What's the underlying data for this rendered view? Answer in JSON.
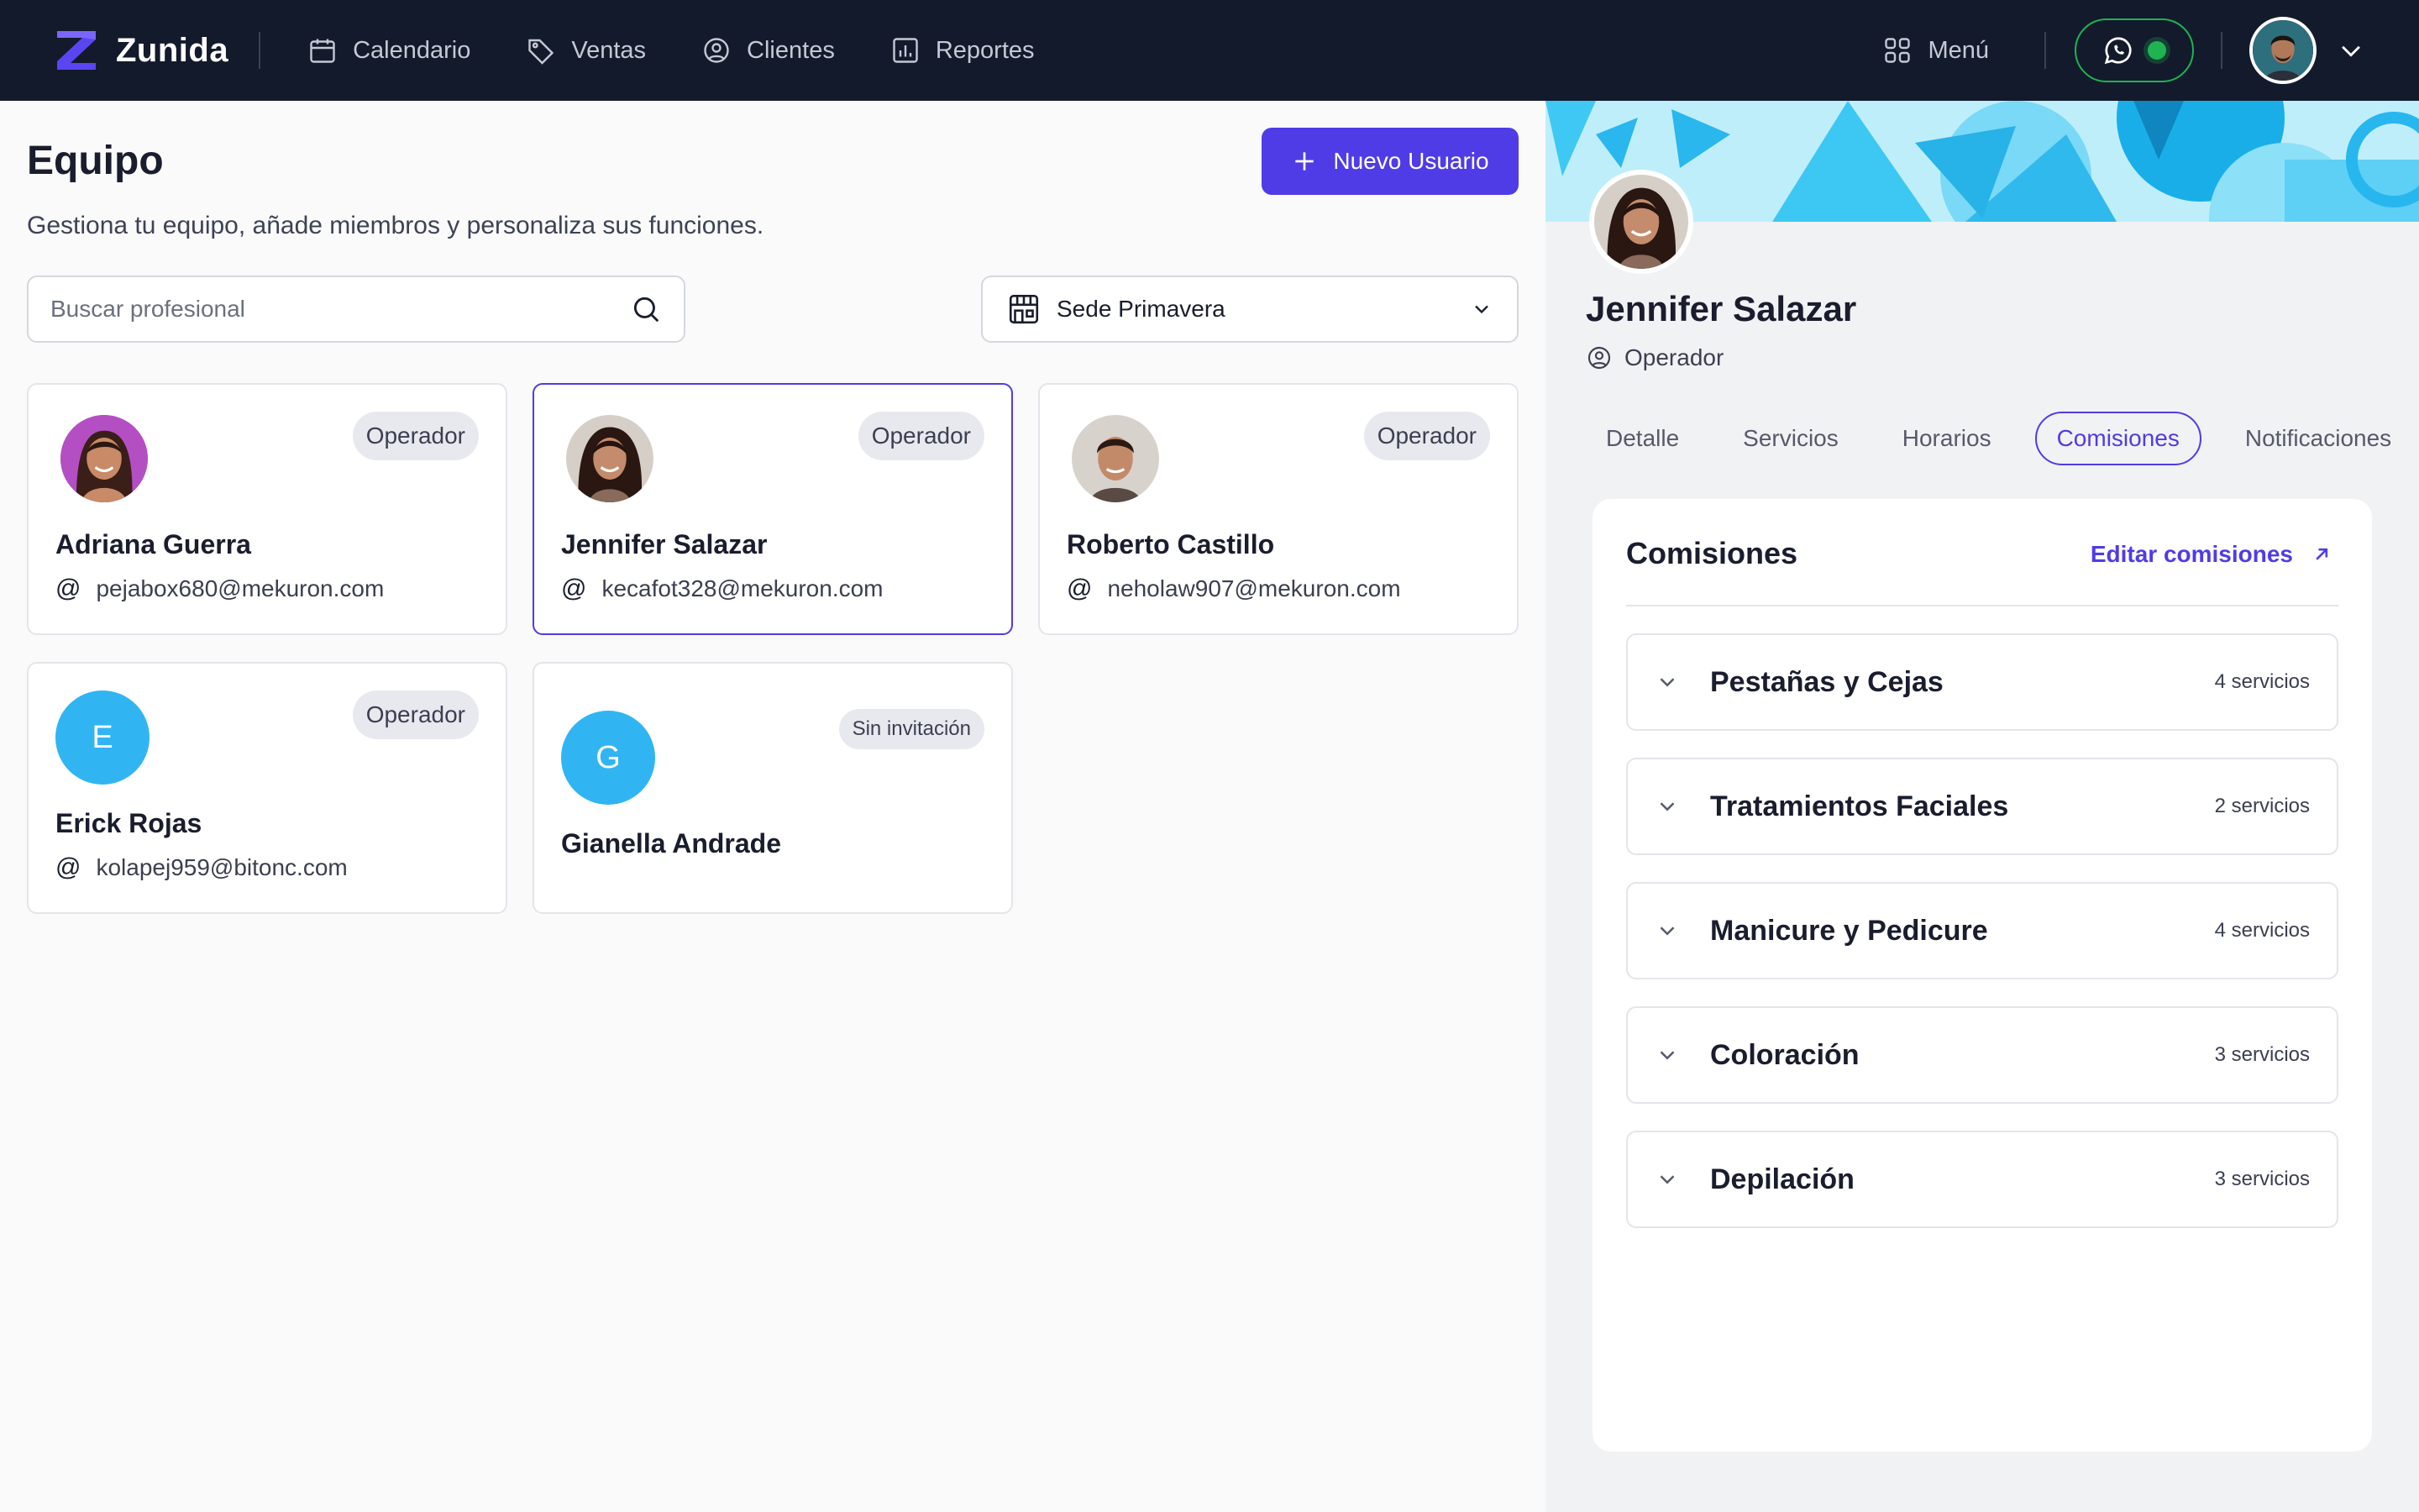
{
  "app": {
    "brand": "Zunida"
  },
  "nav": {
    "items": [
      {
        "label": "Calendario",
        "icon": "calendar-icon"
      },
      {
        "label": "Ventas",
        "icon": "tag-icon"
      },
      {
        "label": "Clientes",
        "icon": "user-circle-icon"
      },
      {
        "label": "Reportes",
        "icon": "bar-chart-icon"
      }
    ],
    "menu_label": "Menú",
    "whatsapp_status_color": "#1fb352"
  },
  "page": {
    "title": "Equipo",
    "subtitle": "Gestiona tu equipo, añade miembros y personaliza sus funciones.",
    "new_user_label": "Nuevo Usuario",
    "search_placeholder": "Buscar profesional",
    "sede_selected": "Sede Primavera"
  },
  "team": [
    {
      "name": "Adriana Guerra",
      "email": "pejabox680@mekuron.com",
      "role": "Operador"
    },
    {
      "name": "Jennifer Salazar",
      "email": "kecafot328@mekuron.com",
      "role": "Operador",
      "selected": true
    },
    {
      "name": "Roberto Castillo",
      "email": "neholaw907@mekuron.com",
      "role": "Operador"
    },
    {
      "name": "Erick Rojas",
      "email": "kolapej959@bitonc.com",
      "role": "Operador",
      "initial": "E"
    },
    {
      "name": "Gianella Andrade",
      "email": "",
      "role": "Sin invitación",
      "initial": "G"
    }
  ],
  "detail": {
    "name": "Jennifer Salazar",
    "role": "Operador",
    "tabs": [
      "Detalle",
      "Servicios",
      "Horarios",
      "Comisiones",
      "Notificaciones"
    ],
    "active_tab": "Comisiones",
    "commissions": {
      "title": "Comisiones",
      "edit_label": "Editar comisiones",
      "groups": [
        {
          "name": "Pestañas y Cejas",
          "count": "4 servicios"
        },
        {
          "name": "Tratamientos Faciales",
          "count": "2 servicios"
        },
        {
          "name": "Manicure y Pedicure",
          "count": "4 servicios"
        },
        {
          "name": "Coloración",
          "count": "3 servicios"
        },
        {
          "name": "Depilación",
          "count": "3 servicios"
        }
      ]
    }
  },
  "colors": {
    "accent": "#4f3ce6",
    "navbar": "#131a2c",
    "avatar_initial_bg": "#30b5f2"
  }
}
